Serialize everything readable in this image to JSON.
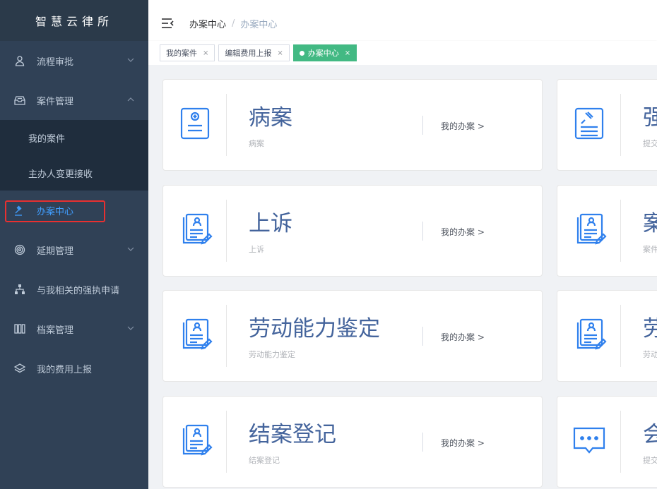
{
  "brand": {
    "title": "智慧云律所"
  },
  "sidebar": {
    "items": [
      {
        "label": "流程审批",
        "icon": "user-icon"
      },
      {
        "label": "案件管理",
        "icon": "inbox-icon"
      },
      {
        "label": "办案中心",
        "icon": "gavel-icon"
      },
      {
        "label": "延期管理",
        "icon": "target-icon"
      },
      {
        "label": "与我相关的强执申请",
        "icon": "sitemap-icon"
      },
      {
        "label": "档案管理",
        "icon": "archive-icon"
      },
      {
        "label": "我的费用上报",
        "icon": "layers-icon"
      }
    ],
    "subitems": [
      {
        "label": "我的案件"
      },
      {
        "label": "主办人变更接收"
      }
    ]
  },
  "navbar": {
    "breadcrumb": [
      "办案中心",
      "办案中心"
    ],
    "separator": "/"
  },
  "tags": [
    {
      "label": "我的案件",
      "close": "×"
    },
    {
      "label": "编辑费用上报",
      "close": "×"
    },
    {
      "label": "办案中心",
      "close": "×"
    }
  ],
  "cards": [
    {
      "title": "病案",
      "subtitle": "病案",
      "link": "我的办案 >",
      "icon": "medical-file-icon"
    },
    {
      "title": "强",
      "subtitle": "提交",
      "icon": "document-icon"
    },
    {
      "title": "上诉",
      "subtitle": "上诉",
      "link": "我的办案 >",
      "icon": "person-file-icon"
    },
    {
      "title": "案",
      "subtitle": "案件",
      "icon": "person-file-icon"
    },
    {
      "title": "劳动能力鉴定",
      "subtitle": "劳动能力鉴定",
      "link": "我的办案 >",
      "icon": "person-file-icon"
    },
    {
      "title": "劳",
      "subtitle": "劳动",
      "icon": "person-file-icon"
    },
    {
      "title": "结案登记",
      "subtitle": "结案登记",
      "link": "我的办案 >",
      "icon": "person-file-icon"
    },
    {
      "title": "会",
      "subtitle": "提交",
      "icon": "chat-icon"
    }
  ],
  "colors": {
    "sidebar_bg": "#304156",
    "sidebar_active": "#409eff",
    "tag_active": "#42b983",
    "card_title": "#44649c",
    "icon_blue": "#2f80ed"
  }
}
